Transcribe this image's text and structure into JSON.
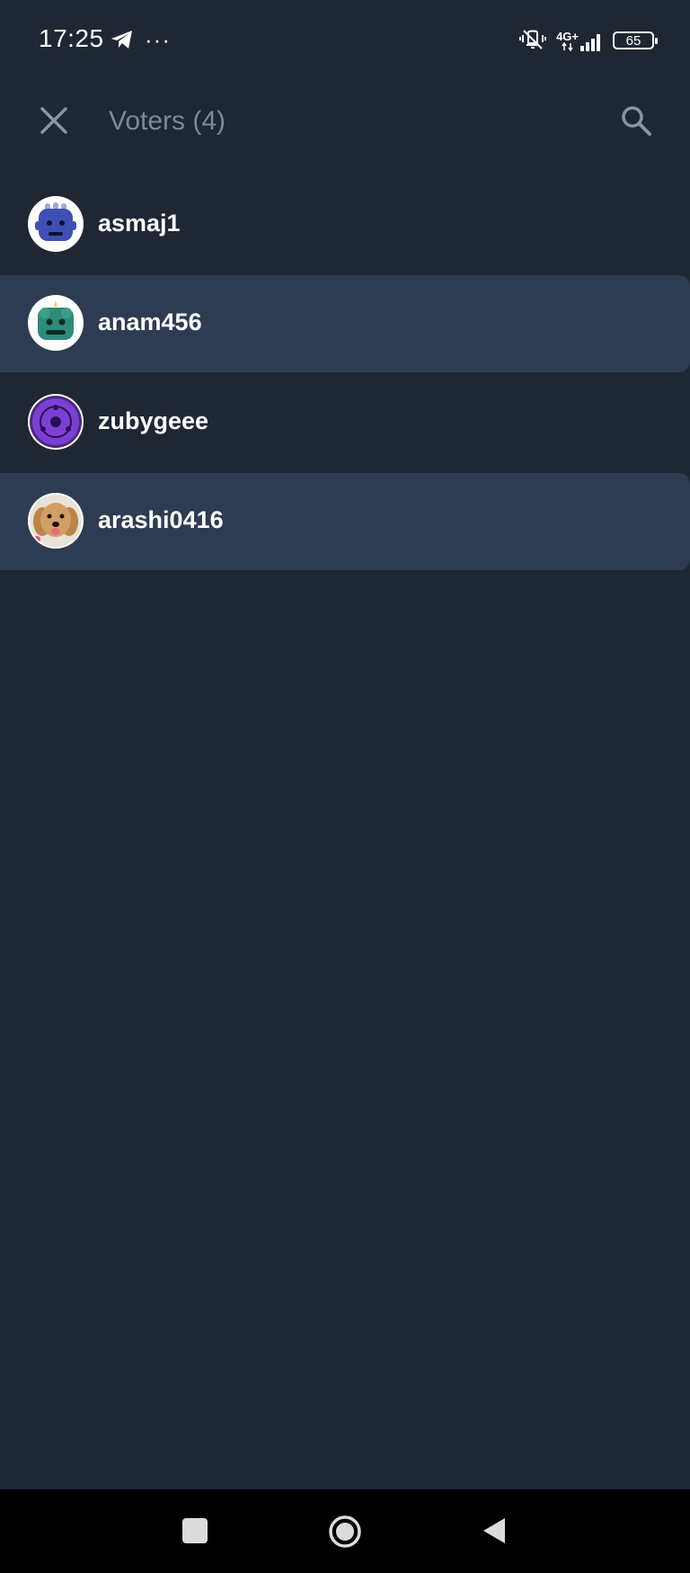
{
  "status_bar": {
    "time": "17:25",
    "more": "···",
    "network": "4G+",
    "battery": "65"
  },
  "header": {
    "title": "Voters (4)",
    "close_icon": "close-icon",
    "search_icon": "search-icon"
  },
  "voters": [
    {
      "name": "asmaj1",
      "avatar": "blue-robot-avatar"
    },
    {
      "name": "anam456",
      "avatar": "green-monster-avatar"
    },
    {
      "name": "zubygeee",
      "avatar": "purple-eye-avatar"
    },
    {
      "name": "arashi0416",
      "avatar": "dog-photo-avatar"
    }
  ],
  "colors": {
    "background": "#1f2733",
    "highlight_row": "#2d3c52",
    "title_text": "#7d8894"
  }
}
